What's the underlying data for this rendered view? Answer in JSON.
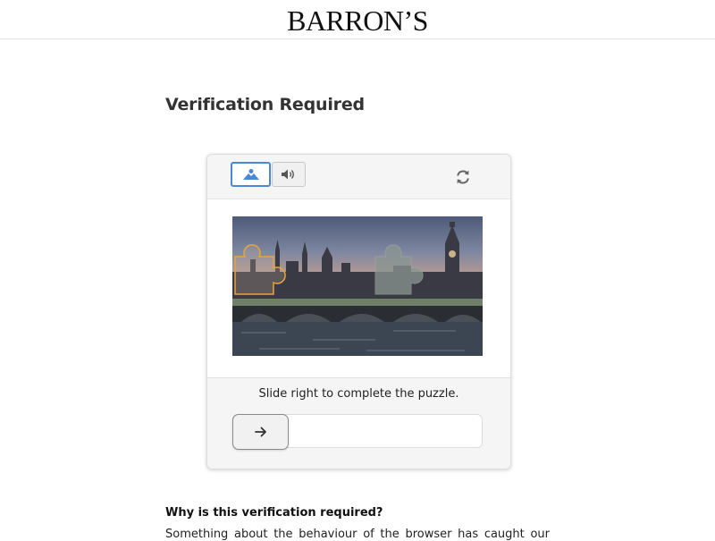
{
  "header": {
    "logo_text": "BARRON’S"
  },
  "page": {
    "title": "Verification Required"
  },
  "captcha": {
    "modes": [
      "image-mode",
      "audio-mode"
    ],
    "selected_mode": "image-mode",
    "instruction": "Slide right to complete the puzzle.",
    "colors": {
      "accent": "#4a88d6",
      "piece_outline": "#e7a43a"
    }
  },
  "info": {
    "heading": "Why is this verification required?",
    "text": "Something about the behaviour of the browser has caught our"
  }
}
